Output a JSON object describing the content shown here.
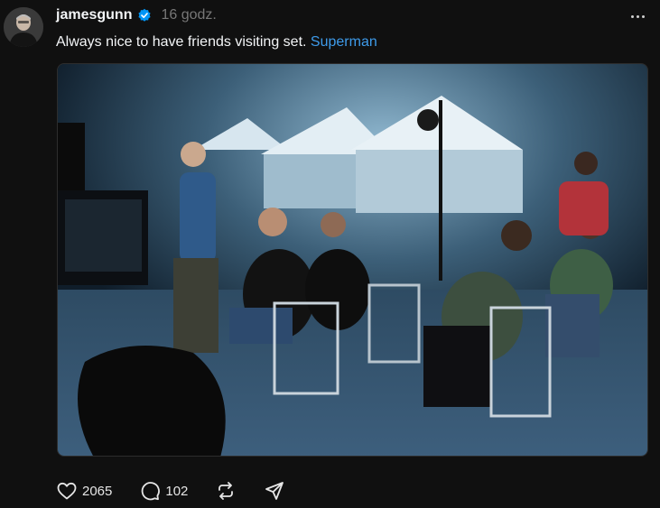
{
  "post": {
    "username": "jamesgunn",
    "verified": true,
    "timestamp": "16 godz.",
    "caption_text": "Always nice to have friends visiting set.",
    "caption_link": "Superman",
    "likes": "2065",
    "comments": "102"
  },
  "icons": {
    "verified": "verified-badge-icon",
    "more": "more-options-icon",
    "like": "heart-icon",
    "comment": "comment-icon",
    "repost": "repost-icon",
    "share": "share-icon"
  },
  "colors": {
    "background": "#101010",
    "text": "#f3f5f7",
    "muted": "#777777",
    "link": "#3e9bea",
    "verified": "#0095f6"
  }
}
